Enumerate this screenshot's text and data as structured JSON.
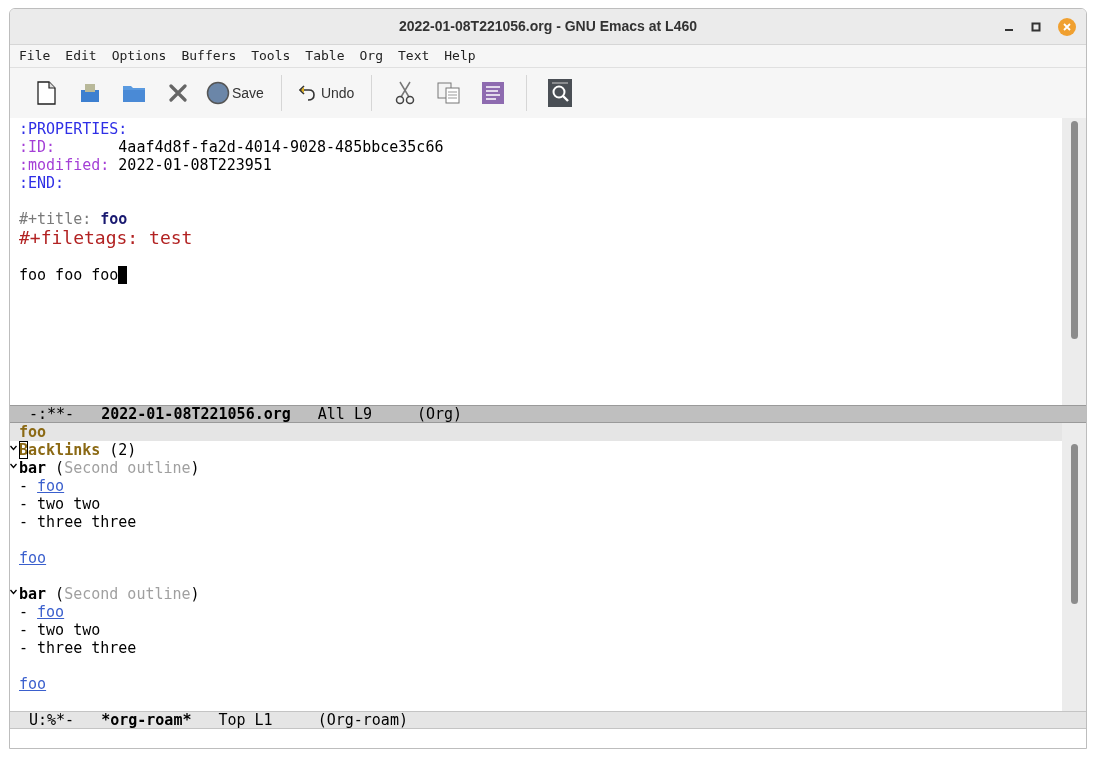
{
  "window": {
    "title": "2022-01-08T221056.org - GNU Emacs at L460"
  },
  "menu": [
    "File",
    "Edit",
    "Options",
    "Buffers",
    "Tools",
    "Table",
    "Org",
    "Text",
    "Help"
  ],
  "toolbar": [
    {
      "kind": "new-file"
    },
    {
      "kind": "save-disk"
    },
    {
      "kind": "folder"
    },
    {
      "kind": "close"
    },
    {
      "kind": "save",
      "label": "Save"
    },
    {
      "kind": "separator"
    },
    {
      "kind": "undo",
      "label": "Undo"
    },
    {
      "kind": "separator"
    },
    {
      "kind": "cut"
    },
    {
      "kind": "copy"
    },
    {
      "kind": "paste"
    },
    {
      "kind": "separator"
    },
    {
      "kind": "search"
    }
  ],
  "upper_buffer": {
    "lines": [
      {
        "segments": [
          {
            "text": ":PROPERTIES:",
            "kind": "keyword"
          }
        ]
      },
      {
        "segments": [
          {
            "text": ":ID:       ",
            "kind": "property"
          },
          {
            "text": "4aaf4d8f-fa2d-4014-9028-485bbce35c66",
            "kind": "plain"
          }
        ]
      },
      {
        "segments": [
          {
            "text": ":modified: ",
            "kind": "property"
          },
          {
            "text": "2022-01-08T223951",
            "kind": "plain"
          }
        ]
      },
      {
        "segments": [
          {
            "text": ":END:",
            "kind": "keyword"
          }
        ]
      },
      {
        "kind": "blank"
      },
      {
        "segments": [
          {
            "text": "#+title: ",
            "kind": "meta"
          },
          {
            "text": "foo",
            "kind": "title"
          }
        ]
      },
      {
        "segments": [
          {
            "text": "#+filetags: test",
            "kind": "filetags"
          }
        ]
      },
      {
        "kind": "blank"
      },
      {
        "segments": [
          {
            "text": "foo foo foo",
            "kind": "plain"
          }
        ],
        "cursor": true
      }
    ]
  },
  "upper_mode_line": {
    "active": true,
    "segments": [
      {
        "text": "-:**-",
        "bold": false
      },
      {
        "text": "2022-01-08T221056.org",
        "bold": true
      },
      {
        "text": "All L9",
        "bold": false
      },
      {
        "text": "(Org)",
        "bold": false
      }
    ]
  },
  "lower_header_line": "foo",
  "lower_buffer": {
    "lines": [
      {
        "expanded": true,
        "segments": [
          {
            "text": "B",
            "kind": "heading-boxed"
          },
          {
            "text": "acklinks",
            "kind": "heading"
          },
          {
            "text": " (2)",
            "kind": "plain"
          }
        ]
      },
      {
        "expanded": true,
        "segments": [
          {
            "text": "bar",
            "kind": "bold"
          },
          {
            "text": " (",
            "kind": "plain"
          },
          {
            "text": "Second outline",
            "kind": "dim"
          },
          {
            "text": ")",
            "kind": "plain"
          }
        ]
      },
      {
        "segments": [
          {
            "text": "- ",
            "kind": "plain"
          },
          {
            "text": "foo",
            "kind": "link"
          }
        ]
      },
      {
        "segments": [
          {
            "text": "- two two",
            "kind": "plain"
          }
        ]
      },
      {
        "segments": [
          {
            "text": "- three three",
            "kind": "plain"
          }
        ]
      },
      {
        "kind": "blank"
      },
      {
        "segments": [
          {
            "text": "foo",
            "kind": "link"
          }
        ]
      },
      {
        "kind": "blank"
      },
      {
        "expanded": true,
        "segments": [
          {
            "text": "bar",
            "kind": "bold"
          },
          {
            "text": " (",
            "kind": "plain"
          },
          {
            "text": "Second outline",
            "kind": "dim"
          },
          {
            "text": ")",
            "kind": "plain"
          }
        ]
      },
      {
        "segments": [
          {
            "text": "- ",
            "kind": "plain"
          },
          {
            "text": "foo",
            "kind": "link"
          }
        ]
      },
      {
        "segments": [
          {
            "text": "- two two",
            "kind": "plain"
          }
        ]
      },
      {
        "segments": [
          {
            "text": "- three three",
            "kind": "plain"
          }
        ]
      },
      {
        "kind": "blank"
      },
      {
        "segments": [
          {
            "text": "foo",
            "kind": "link"
          }
        ]
      }
    ]
  },
  "lower_mode_line": {
    "active": false,
    "segments": [
      {
        "text": "U:%*-",
        "bold": false
      },
      {
        "text": "*org-roam*",
        "bold": true
      },
      {
        "text": "Top L1",
        "bold": false
      },
      {
        "text": "(Org-roam)",
        "bold": false
      }
    ]
  }
}
